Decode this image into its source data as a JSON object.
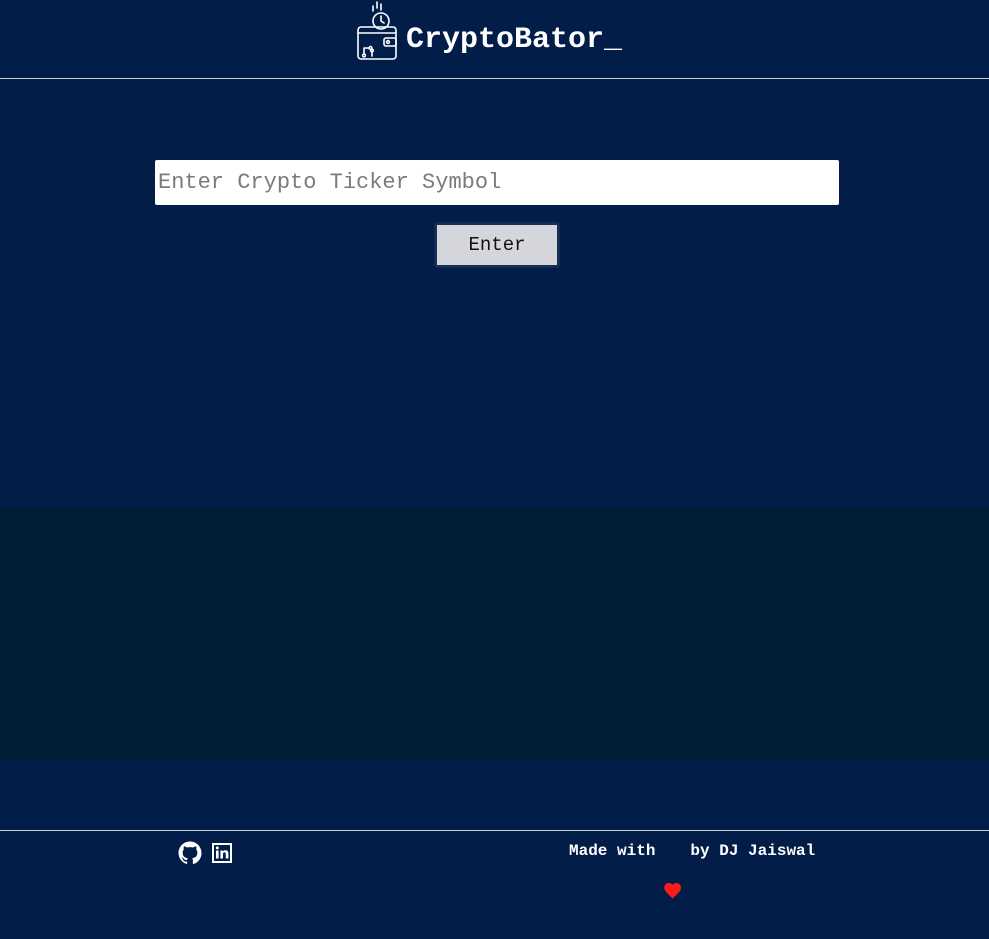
{
  "header": {
    "logo_icon": "crypto-wallet-icon",
    "brand_name": "CryptoBator_"
  },
  "search": {
    "placeholder": "Enter Crypto Ticker Symbol",
    "value": "",
    "button_label": "Enter"
  },
  "footer": {
    "social_links": [
      {
        "icon": "github-icon"
      },
      {
        "icon": "linkedin-icon"
      }
    ],
    "credit_prefix": "Made with",
    "credit_icon": "heart-icon",
    "credit_suffix": "by DJ Jaiswal"
  },
  "colors": {
    "background": "#021e48",
    "results_panel": "#011e37",
    "text": "#ffffff",
    "heart": "#ff1a1a",
    "button": "#d4d6dc"
  }
}
